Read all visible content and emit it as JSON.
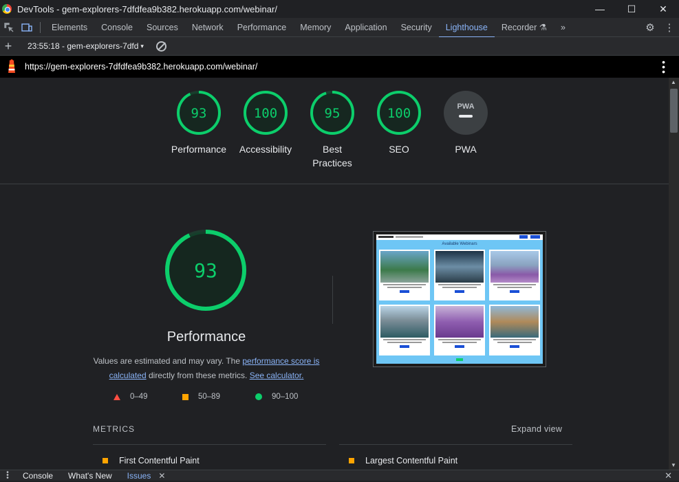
{
  "window": {
    "title": "DevTools - gem-explorers-7dfdfea9b382.herokuapp.com/webinar/",
    "controls": {
      "minimize": "—",
      "maximize": "☐",
      "close": "✕"
    }
  },
  "tabs": [
    {
      "label": "Elements"
    },
    {
      "label": "Console"
    },
    {
      "label": "Sources"
    },
    {
      "label": "Network"
    },
    {
      "label": "Performance"
    },
    {
      "label": "Memory"
    },
    {
      "label": "Application"
    },
    {
      "label": "Security"
    },
    {
      "label": "Lighthouse",
      "active": true
    },
    {
      "label": "Recorder ⚗"
    }
  ],
  "toolbar": {
    "more_tabs": "»",
    "settings_icon": "⚙",
    "menu_icon": "⋮"
  },
  "lighthouse_bar": {
    "add": "+",
    "report": "23:55:18 - gem-explorers-7dfd",
    "caret": "▾"
  },
  "url_bar": {
    "url": "https://gem-explorers-7dfdfea9b382.herokuapp.com/webinar/"
  },
  "scores": [
    {
      "label": "Performance",
      "value": "93",
      "pct": 93
    },
    {
      "label": "Accessibility",
      "value": "100",
      "pct": 100
    },
    {
      "label": "Best\nPractices",
      "value": "95",
      "pct": 95
    },
    {
      "label": "SEO",
      "value": "100",
      "pct": 100
    },
    {
      "label": "PWA",
      "value": "",
      "badge": "PWA"
    }
  ],
  "performance": {
    "score": "93",
    "pct": 93,
    "title": "Performance",
    "disclaimer_pre": "Values are estimated and may vary. The ",
    "link1": "performance score is calculated",
    "disclaimer_mid": " directly from these metrics. ",
    "link2": "See calculator."
  },
  "legend": [
    {
      "range": "0–49"
    },
    {
      "range": "50–89"
    },
    {
      "range": "90–100"
    }
  ],
  "screenshot": {
    "heading": "Available Webinars"
  },
  "metrics": {
    "heading": "METRICS",
    "expand": "Expand view",
    "items": [
      {
        "label": "First Contentful Paint"
      },
      {
        "label": "Largest Contentful Paint"
      }
    ]
  },
  "drawer": {
    "tabs": [
      {
        "label": "Console"
      },
      {
        "label": "What's New"
      },
      {
        "label": "Issues",
        "active": true
      }
    ],
    "close_tab": "✕",
    "close": "✕"
  },
  "colors": {
    "pass": "#0cce6b",
    "average": "#ffa400",
    "fail": "#ff4e42",
    "link": "#8ab4f8"
  }
}
